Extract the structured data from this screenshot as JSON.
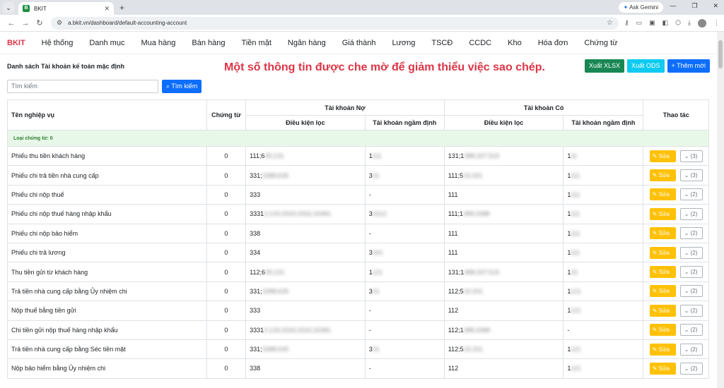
{
  "browser": {
    "tab_title": "BKIT",
    "favicon_letter": "B",
    "url": "a.bkit.vn/dashboard/default-accounting-account",
    "ask_gemini": "Ask Gemini"
  },
  "menu": {
    "brand": "BKIT",
    "items": [
      "Hệ thống",
      "Danh mục",
      "Mua hàng",
      "Bán hàng",
      "Tiền mặt",
      "Ngân hàng",
      "Giá thành",
      "Lương",
      "TSCĐ",
      "CCDC",
      "Kho",
      "Hóa đơn",
      "Chứng từ"
    ]
  },
  "page": {
    "title": "Danh sách Tài khoản kế toán mặc định",
    "notice": "Một số thông tin được che mờ để giảm thiểu việc sao chép.",
    "export_xlsx": "Xuất XLSX",
    "export_ods": "Xuất ODS",
    "add_new": "+ Thêm mới",
    "search_placeholder": "Tìm kiếm",
    "search_button": "Tìm kiếm"
  },
  "table": {
    "headers": {
      "name": "Tên nghiệp vụ",
      "voucher": "Chứng từ",
      "debit": "Tài khoản Nợ",
      "credit": "Tài khoản Có",
      "filter": "Điều kiện lọc",
      "default": "Tài khoản ngầm định",
      "actions": "Thao tác"
    },
    "group_label": "Loại chứng từ: 0",
    "edit_label": "✎ Sửa",
    "rows": [
      {
        "name": "Phiếu thu tiền khách hàng",
        "voucher": "0",
        "debit_filter": "111;6",
        "debit_filter_blur": "35;131",
        "debit_default": "1",
        "debit_default_blur": "111",
        "credit_filter": "131;1",
        "credit_filter_blur": "388;337;515",
        "credit_default": "1",
        "credit_default_blur": "11",
        "more": "(3)"
      },
      {
        "name": "Phiếu chi trả tiền nhà cung cấp",
        "voucher": "0",
        "debit_filter": "331;",
        "debit_filter_blur": "3388;635",
        "debit_default": "3",
        "debit_default_blur": "31",
        "credit_filter": "111;5",
        "credit_filter_blur": "15;331",
        "credit_default": "1",
        "credit_default_blur": "111",
        "more": "(3)"
      },
      {
        "name": "Phiếu chi nộp thuế",
        "voucher": "0",
        "debit_filter": "333",
        "debit_filter_blur": "",
        "debit_default": "-",
        "debit_default_blur": "",
        "credit_filter": "111",
        "credit_filter_blur": "",
        "credit_default": "1",
        "credit_default_blur": "111",
        "more": "(2)"
      },
      {
        "name": "Phiếu chi nộp thuế hàng nhập khẩu",
        "voucher": "0",
        "debit_filter": "3331",
        "debit_filter_blur": "2;133;3333;3332;33381",
        "debit_default": "3",
        "debit_default_blur": "3312",
        "credit_filter": "111;1",
        "credit_filter_blur": "388;3388",
        "credit_default": "1",
        "credit_default_blur": "111",
        "more": "(2)"
      },
      {
        "name": "Phiếu chi nộp bảo hiểm",
        "voucher": "0",
        "debit_filter": "338",
        "debit_filter_blur": "",
        "debit_default": "-",
        "debit_default_blur": "",
        "credit_filter": "111",
        "credit_filter_blur": "",
        "credit_default": "1",
        "credit_default_blur": "111",
        "more": "(2)"
      },
      {
        "name": "Phiếu chi trả lương",
        "voucher": "0",
        "debit_filter": "334",
        "debit_filter_blur": "",
        "debit_default": "3",
        "debit_default_blur": "341",
        "credit_filter": "111",
        "credit_filter_blur": "",
        "credit_default": "1",
        "credit_default_blur": "111",
        "more": "(2)"
      },
      {
        "name": "Thu tiền gửi từ khách hàng",
        "voucher": "0",
        "debit_filter": "112;6",
        "debit_filter_blur": "35;131",
        "debit_default": "1",
        "debit_default_blur": "121",
        "credit_filter": "131;1",
        "credit_filter_blur": "388;337;515",
        "credit_default": "1",
        "credit_default_blur": "31",
        "more": "(2)"
      },
      {
        "name": "Trả tiền nhà cung cấp bằng Ủy nhiệm chi",
        "voucher": "0",
        "debit_filter": "331;",
        "debit_filter_blur": "3388;635",
        "debit_default": "3",
        "debit_default_blur": "31",
        "credit_filter": "112;5",
        "credit_filter_blur": "15;331",
        "credit_default": "1",
        "credit_default_blur": "121",
        "more": "(2)"
      },
      {
        "name": "Nộp thuế bằng tiền gửi",
        "voucher": "0",
        "debit_filter": "333",
        "debit_filter_blur": "",
        "debit_default": "-",
        "debit_default_blur": "",
        "credit_filter": "112",
        "credit_filter_blur": "",
        "credit_default": "1",
        "credit_default_blur": "121",
        "more": "(2)"
      },
      {
        "name": "Chi tiền gửi nộp thuế hàng nhập khẩu",
        "voucher": "0",
        "debit_filter": "3331",
        "debit_filter_blur": "2;133;3333;3332;33381",
        "debit_default": "-",
        "debit_default_blur": "",
        "credit_filter": "112;1",
        "credit_filter_blur": "388;3388",
        "credit_default": "-",
        "credit_default_blur": "",
        "more": "(2)"
      },
      {
        "name": "Trả tiền nhà cung cấp bằng Séc tiền mặt",
        "voucher": "0",
        "debit_filter": "331;",
        "debit_filter_blur": "3388;635",
        "debit_default": "3",
        "debit_default_blur": "31",
        "credit_filter": "112;5",
        "credit_filter_blur": "15;331",
        "credit_default": "1",
        "credit_default_blur": "121",
        "more": "(2)"
      },
      {
        "name": "Nộp bảo hiểm bằng Ủy nhiệm chi",
        "voucher": "0",
        "debit_filter": "338",
        "debit_filter_blur": "",
        "debit_default": "-",
        "debit_default_blur": "",
        "credit_filter": "112",
        "credit_filter_blur": "",
        "credit_default": "1",
        "credit_default_blur": "121",
        "more": "(2)"
      }
    ]
  }
}
